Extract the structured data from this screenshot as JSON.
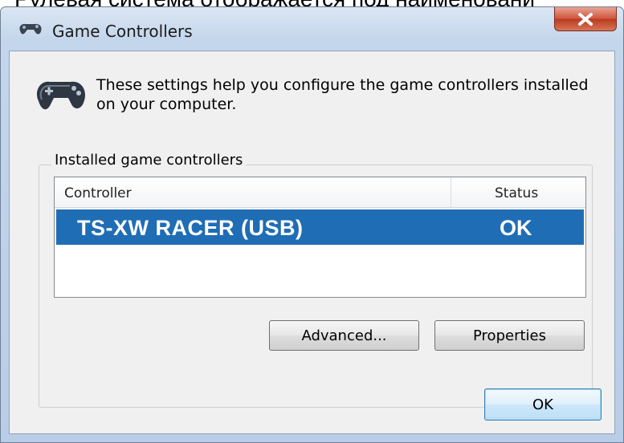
{
  "top_text": "Рулевая система отображается под наименовани",
  "window": {
    "title": "Game Controllers",
    "close_label": "x"
  },
  "description": "These settings help you configure the game controllers installed on your computer.",
  "group": {
    "label": "Installed game controllers",
    "columns": {
      "controller": "Controller",
      "status": "Status"
    },
    "rows": [
      {
        "controller": "TS-XW RACER (USB)",
        "status": "OK"
      }
    ]
  },
  "buttons": {
    "advanced": "Advanced...",
    "properties": "Properties",
    "ok": "OK"
  },
  "colors": {
    "selection": "#1f6db5",
    "close_button": "#c8462b"
  }
}
